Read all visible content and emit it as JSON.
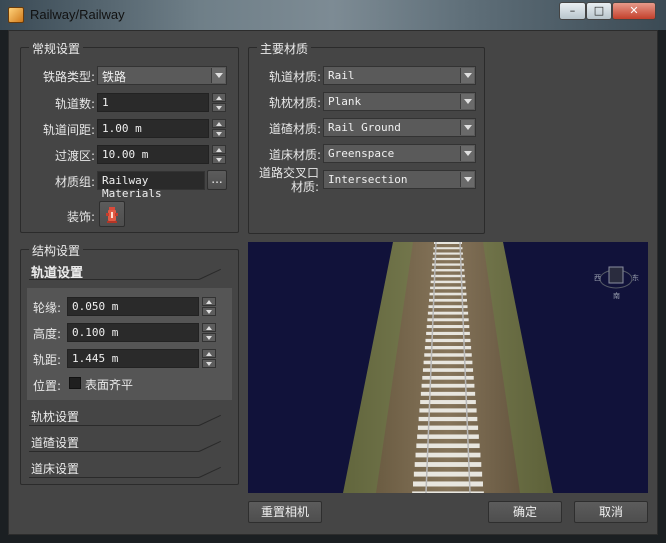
{
  "window": {
    "title": "Railway/Railway",
    "min_label": "–",
    "max_label": "□",
    "close_label": "✕"
  },
  "general": {
    "title": "常规设置",
    "rail_type_label": "铁路类型:",
    "rail_type_value": "铁路",
    "track_count_label": "轨道数:",
    "track_count_value": "1",
    "track_spacing_label": "轨道间距:",
    "track_spacing_value": "1.00 m",
    "transition_label": "过渡区:",
    "transition_value": "10.00 m",
    "material_group_label": "材质组:",
    "material_group_value": "Railway Materials",
    "browse_label": "...",
    "decoration_label": "装饰:"
  },
  "materials": {
    "title": "主要材质",
    "items": [
      {
        "label": "轨道材质:",
        "value": "Rail"
      },
      {
        "label": "轨枕材质:",
        "value": "Plank"
      },
      {
        "label": "道碴材质:",
        "value": "Rail Ground"
      },
      {
        "label": "道床材质:",
        "value": "Greenspace"
      },
      {
        "label": "道路交叉口材质:",
        "value": "Intersection"
      }
    ]
  },
  "structure": {
    "title": "结构设置",
    "track_section": "轨道设置",
    "flange_label": "轮缘:",
    "flange_value": "0.050 m",
    "height_label": "高度:",
    "height_value": "0.100 m",
    "gauge_label": "轨距:",
    "gauge_value": "1.445 m",
    "position_label": "位置:",
    "position_checkbox_label": "表面齐平",
    "sleeper_section": "轨枕设置",
    "ballast_section": "道碴设置",
    "bed_section": "道床设置"
  },
  "viewport": {
    "compass_west": "西",
    "compass_east": "东",
    "compass_south": "南"
  },
  "buttons": {
    "reset_camera": "重置相机",
    "ok": "确定",
    "cancel": "取消"
  },
  "colors": {
    "viewport_bg": "#11123a",
    "grass": "#6f7246",
    "ballast": "#7a6a4c",
    "sleeper": "#e8e6df"
  }
}
